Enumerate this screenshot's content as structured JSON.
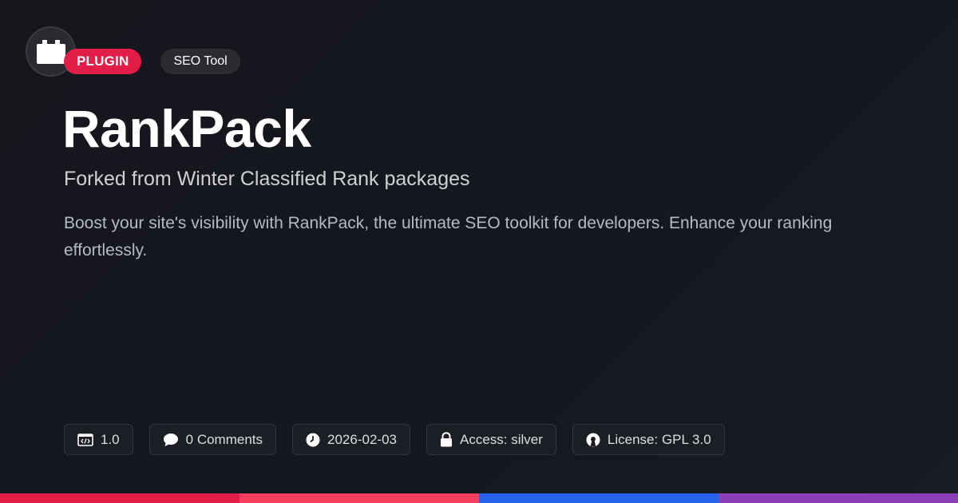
{
  "badges": {
    "type_label": "PLUGIN",
    "category_label": "SEO Tool"
  },
  "title": "RankPack",
  "subtitle": "Forked from Winter Classified Rank packages",
  "description": "Boost your site's visibility with RankPack, the ultimate SEO toolkit for developers. Enhance your ranking effortlessly.",
  "meta": {
    "version": "1.0",
    "comments": "0 Comments",
    "date": "2026-02-03",
    "access": "Access: silver",
    "license": "License: GPL 3.0"
  },
  "icons": {
    "logo": "plugin-block-icon",
    "version": "code-window-icon",
    "comments": "speech-bubble-icon",
    "date": "clock-icon",
    "access": "lock-icon",
    "license": "open-source-icon"
  },
  "colors": {
    "accent": "#e11d48",
    "bar": [
      "#e11d48",
      "#f43f5e",
      "#2563eb",
      "#8b3fb5"
    ]
  }
}
